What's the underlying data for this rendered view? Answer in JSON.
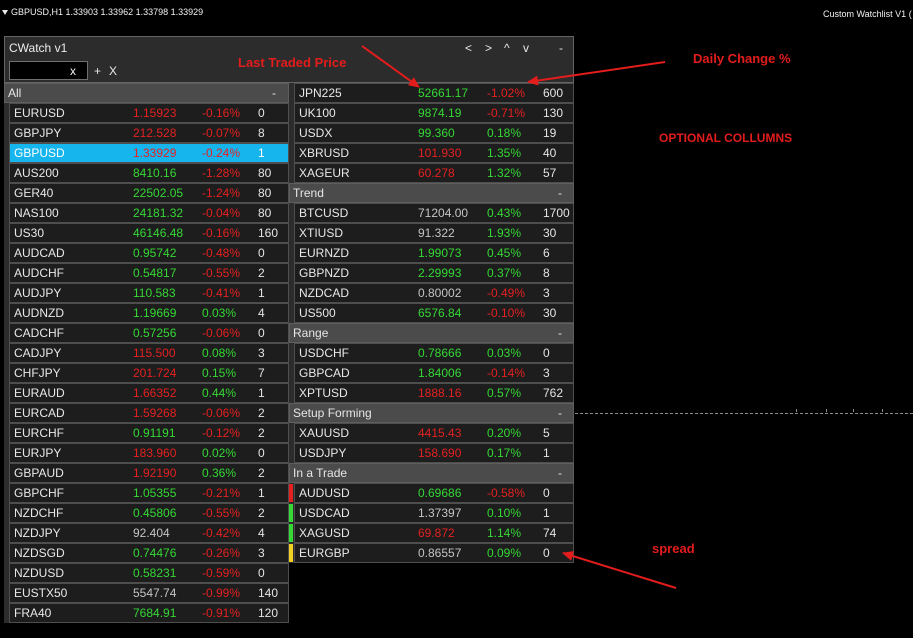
{
  "chart_header": {
    "symbol_info": "GBPUSD,H1  1.33903 1.33962 1.33798 1.33929",
    "indicator_label": "Custom Watchlist V1 ("
  },
  "panel": {
    "title": "CWatch v1",
    "nav": {
      "prev": "<",
      "next": ">",
      "up": "^",
      "down": "v",
      "minimize": "-"
    },
    "search": {
      "value": "",
      "clear": "x"
    },
    "add": "+",
    "remove": "X"
  },
  "colors": {
    "green": "#35d835",
    "red": "#e52020",
    "gray": "#c4c4c4",
    "yellow": "#f0d020",
    "selected_bg": "#16b5ee",
    "annotation": "#e31c1c"
  },
  "annotations": {
    "last_traded_price": "Last Traded Price",
    "daily_change": "Daily Change %",
    "optional_columns": "OPTIONAL COLLUMNS",
    "spread": "spread"
  },
  "watchlist": {
    "left": [
      {
        "header": "All",
        "toggle": "-"
      },
      {
        "symbol": "EURUSD",
        "price": "1.15923",
        "price_color": "red",
        "change": "-0.16%",
        "change_color": "red",
        "spread": "0"
      },
      {
        "symbol": "GBPJPY",
        "price": "212.528",
        "price_color": "red",
        "change": "-0.07%",
        "change_color": "red",
        "spread": "8"
      },
      {
        "symbol": "GBPUSD",
        "price": "1.33929",
        "price_color": "red",
        "change": "-0.24%",
        "change_color": "red",
        "spread": "1",
        "selected": true
      },
      {
        "symbol": "AUS200",
        "price": "8410.16",
        "price_color": "green",
        "change": "-1.28%",
        "change_color": "red",
        "spread": "80"
      },
      {
        "symbol": "GER40",
        "price": "22502.05",
        "price_color": "green",
        "change": "-1.24%",
        "change_color": "red",
        "spread": "80"
      },
      {
        "symbol": "NAS100",
        "price": "24181.32",
        "price_color": "green",
        "change": "-0.04%",
        "change_color": "red",
        "spread": "80"
      },
      {
        "symbol": "US30",
        "price": "46146.48",
        "price_color": "green",
        "change": "-0.16%",
        "change_color": "red",
        "spread": "160"
      },
      {
        "symbol": "AUDCAD",
        "price": "0.95742",
        "price_color": "green",
        "change": "-0.48%",
        "change_color": "red",
        "spread": "0"
      },
      {
        "symbol": "AUDCHF",
        "price": "0.54817",
        "price_color": "green",
        "change": "-0.55%",
        "change_color": "red",
        "spread": "2"
      },
      {
        "symbol": "AUDJPY",
        "price": "110.583",
        "price_color": "green",
        "change": "-0.41%",
        "change_color": "red",
        "spread": "1"
      },
      {
        "symbol": "AUDNZD",
        "price": "1.19669",
        "price_color": "green",
        "change": "0.03%",
        "change_color": "green",
        "spread": "4"
      },
      {
        "symbol": "CADCHF",
        "price": "0.57256",
        "price_color": "green",
        "change": "-0.06%",
        "change_color": "red",
        "spread": "0"
      },
      {
        "symbol": "CADJPY",
        "price": "115.500",
        "price_color": "red",
        "change": "0.08%",
        "change_color": "green",
        "spread": "3"
      },
      {
        "symbol": "CHFJPY",
        "price": "201.724",
        "price_color": "red",
        "change": "0.15%",
        "change_color": "green",
        "spread": "7"
      },
      {
        "symbol": "EURAUD",
        "price": "1.66352",
        "price_color": "red",
        "change": "0.44%",
        "change_color": "green",
        "spread": "1"
      },
      {
        "symbol": "EURCAD",
        "price": "1.59268",
        "price_color": "red",
        "change": "-0.06%",
        "change_color": "red",
        "spread": "2"
      },
      {
        "symbol": "EURCHF",
        "price": "0.91191",
        "price_color": "green",
        "change": "-0.12%",
        "change_color": "red",
        "spread": "2"
      },
      {
        "symbol": "EURJPY",
        "price": "183.960",
        "price_color": "red",
        "change": "0.02%",
        "change_color": "green",
        "spread": "0"
      },
      {
        "symbol": "GBPAUD",
        "price": "1.92190",
        "price_color": "red",
        "change": "0.36%",
        "change_color": "green",
        "spread": "2"
      },
      {
        "symbol": "GBPCHF",
        "price": "1.05355",
        "price_color": "green",
        "change": "-0.21%",
        "change_color": "red",
        "spread": "1"
      },
      {
        "symbol": "NZDCHF",
        "price": "0.45806",
        "price_color": "green",
        "change": "-0.55%",
        "change_color": "red",
        "spread": "2"
      },
      {
        "symbol": "NZDJPY",
        "price": "92.404",
        "price_color": "gray",
        "change": "-0.42%",
        "change_color": "red",
        "spread": "4"
      },
      {
        "symbol": "NZDSGD",
        "price": "0.74476",
        "price_color": "green",
        "change": "-0.26%",
        "change_color": "red",
        "spread": "3"
      },
      {
        "symbol": "NZDUSD",
        "price": "0.58231",
        "price_color": "green",
        "change": "-0.59%",
        "change_color": "red",
        "spread": "0"
      },
      {
        "symbol": "EUSTX50",
        "price": "5547.74",
        "price_color": "gray",
        "change": "-0.99%",
        "change_color": "red",
        "spread": "140"
      },
      {
        "symbol": "FRA40",
        "price": "7684.91",
        "price_color": "green",
        "change": "-0.91%",
        "change_color": "red",
        "spread": "120"
      }
    ],
    "right": [
      {
        "symbol": "JPN225",
        "price": "52661.17",
        "price_color": "green",
        "change": "-1.02%",
        "change_color": "red",
        "spread": "600"
      },
      {
        "symbol": "UK100",
        "price": "9874.19",
        "price_color": "green",
        "change": "-0.71%",
        "change_color": "red",
        "spread": "130"
      },
      {
        "symbol": "USDX",
        "price": "99.360",
        "price_color": "green",
        "change": "0.18%",
        "change_color": "green",
        "spread": "19"
      },
      {
        "symbol": "XBRUSD",
        "price": "101.930",
        "price_color": "red",
        "change": "1.35%",
        "change_color": "green",
        "spread": "40"
      },
      {
        "symbol": "XAGEUR",
        "price": "60.278",
        "price_color": "red",
        "change": "1.32%",
        "change_color": "green",
        "spread": "57"
      },
      {
        "header": "Trend",
        "toggle": "-"
      },
      {
        "symbol": "BTCUSD",
        "price": "71204.00",
        "price_color": "gray",
        "change": "0.43%",
        "change_color": "green",
        "spread": "1700"
      },
      {
        "symbol": "XTIUSD",
        "price": "91.322",
        "price_color": "gray",
        "change": "1.93%",
        "change_color": "green",
        "spread": "30"
      },
      {
        "symbol": "EURNZD",
        "price": "1.99073",
        "price_color": "green",
        "change": "0.45%",
        "change_color": "green",
        "spread": "6"
      },
      {
        "symbol": "GBPNZD",
        "price": "2.29993",
        "price_color": "green",
        "change": "0.37%",
        "change_color": "green",
        "spread": "8"
      },
      {
        "symbol": "NZDCAD",
        "price": "0.80002",
        "price_color": "gray",
        "change": "-0.49%",
        "change_color": "red",
        "spread": "3"
      },
      {
        "symbol": "US500",
        "price": "6576.84",
        "price_color": "green",
        "change": "-0.10%",
        "change_color": "red",
        "spread": "30"
      },
      {
        "header": "Range",
        "toggle": "-"
      },
      {
        "symbol": "USDCHF",
        "price": "0.78666",
        "price_color": "green",
        "change": "0.03%",
        "change_color": "green",
        "spread": "0"
      },
      {
        "symbol": "GBPCAD",
        "price": "1.84006",
        "price_color": "green",
        "change": "-0.14%",
        "change_color": "red",
        "spread": "3"
      },
      {
        "symbol": "XPTUSD",
        "price": "1888.16",
        "price_color": "red",
        "change": "0.57%",
        "change_color": "green",
        "spread": "762"
      },
      {
        "header": "Setup Forming",
        "toggle": "-"
      },
      {
        "symbol": "XAUUSD",
        "price": "4415.43",
        "price_color": "red",
        "change": "0.20%",
        "change_color": "green",
        "spread": "5"
      },
      {
        "symbol": "USDJPY",
        "price": "158.690",
        "price_color": "red",
        "change": "0.17%",
        "change_color": "green",
        "spread": "1"
      },
      {
        "header": "In a Trade",
        "toggle": "-"
      },
      {
        "symbol": "AUDUSD",
        "price": "0.69686",
        "price_color": "green",
        "change": "-0.58%",
        "change_color": "red",
        "spread": "0",
        "marker": "red"
      },
      {
        "symbol": "USDCAD",
        "price": "1.37397",
        "price_color": "gray",
        "change": "0.10%",
        "change_color": "green",
        "spread": "1",
        "marker": "green"
      },
      {
        "symbol": "XAGUSD",
        "price": "69.872",
        "price_color": "red",
        "change": "1.14%",
        "change_color": "green",
        "spread": "74",
        "marker": "green"
      },
      {
        "symbol": "EURGBP",
        "price": "0.86557",
        "price_color": "gray",
        "change": "0.09%",
        "change_color": "green",
        "spread": "0",
        "marker": "yellow"
      }
    ]
  }
}
